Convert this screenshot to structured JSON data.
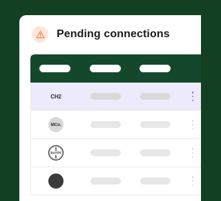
{
  "card": {
    "title": "Pending connections"
  },
  "icons": {
    "alert": "warning-triangle-icon",
    "row_menu": "kebab-menu-icon"
  },
  "colors": {
    "page_background": "#133f23",
    "table_header": "#14482c",
    "selected_row": "#eceafb",
    "alert_icon_bg": "#fde7dc",
    "alert_icon_stroke": "#f08a5d",
    "menu_accent": "#7b79d6"
  },
  "rows": [
    {
      "logo_text": "CH2",
      "selected": true
    },
    {
      "logo_text": "MCo.",
      "selected": false
    },
    {
      "logo_text": "BAYER",
      "selected": false
    },
    {
      "logo_text": "",
      "selected": false
    }
  ]
}
